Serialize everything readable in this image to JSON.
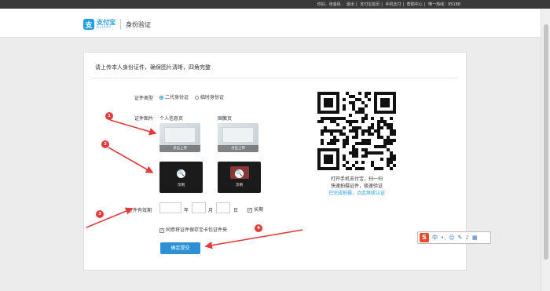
{
  "topbar": {
    "links": [
      "你好，张金凤",
      "退出",
      "支付宝首页",
      "手机支付",
      "帮助中心",
      "唯一热线：95188"
    ]
  },
  "header": {
    "logo_zh": "支付宝",
    "logo_en": "ALIPAY",
    "logo_mark": "支",
    "page_title": "身份验证"
  },
  "card": {
    "title": "请上传本人身份证件，确保图片清晰，四角完整",
    "id_type_label": "证件类型",
    "id_type_options": [
      {
        "label": "二代身份证",
        "selected": true
      },
      {
        "label": "临时身份证",
        "selected": false
      }
    ],
    "id_image_label": "证件图片",
    "front_label": "个人信息页",
    "back_label": "国徽页",
    "upload_caption": "点击上传",
    "example_caption": "示例",
    "validity_label": "证件有效期",
    "year_label": "年",
    "month_label": "月",
    "day_label": "日",
    "long_term_label": "长期",
    "long_term_checked": true,
    "agree_text": "同意将证件保存至卡包证件夹",
    "agree_checked": true,
    "submit_label": "确定提交"
  },
  "qr": {
    "line1": "打开手机支付宝，扫一扫",
    "line2": "快速拍摄证件，极速验证",
    "link": "已完成拍摄，点此继续认证"
  },
  "annotations": [
    "1",
    "2",
    "3",
    "4"
  ],
  "ime": {
    "logo": "S",
    "mode": "中",
    "icons": [
      "comma-icon",
      "smile-icon",
      "pen-icon",
      "mic-icon",
      "grid-icon"
    ]
  },
  "colors": {
    "accent": "#1e9fe6",
    "button": "#2d8fd5",
    "annotation": "#e23b3b"
  }
}
